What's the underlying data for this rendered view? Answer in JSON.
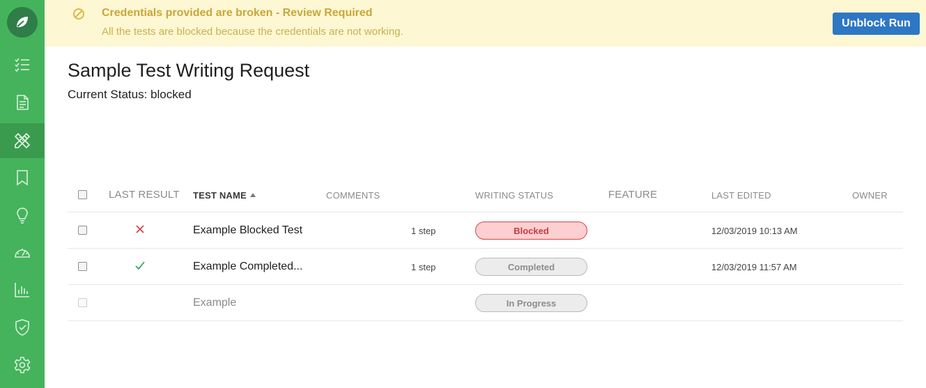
{
  "colors": {
    "sidebar": "#45b35c",
    "sidebar_active": "#3a9b4f",
    "banner_bg": "#fdf7d3",
    "banner_text": "#c8a73b",
    "primary_button": "#2d77c4",
    "blocked_red": "#d9434b",
    "success_green": "#3aa85a"
  },
  "sidebar": {
    "logo_icon": "leaf-icon",
    "items": [
      {
        "icon": "checklist-icon"
      },
      {
        "icon": "document-icon"
      },
      {
        "icon": "pencil-ruler-icon",
        "active": true
      },
      {
        "icon": "bookmark-icon"
      },
      {
        "icon": "lightbulb-icon"
      },
      {
        "icon": "speedometer-icon"
      },
      {
        "icon": "bar-chart-icon"
      },
      {
        "icon": "shield-check-icon"
      },
      {
        "icon": "gear-icon"
      }
    ]
  },
  "banner": {
    "icon": "blocked-icon",
    "title": "Credentials provided are broken - Review Required",
    "subtitle": "All the tests are blocked because the credentials are not working.",
    "button_label": "Unblock Run"
  },
  "page": {
    "title": "Sample Test Writing Request",
    "status": "Current Status: blocked"
  },
  "table": {
    "columns": {
      "last_result": "LAST RESULT",
      "test_name": "TEST NAME",
      "comments": "COMMENTS",
      "writing_status": "WRITING STATUS",
      "feature": "FEATURE",
      "last_edited": "LAST EDITED",
      "owner": "OWNER"
    },
    "rows": [
      {
        "result": "fail",
        "result_icon": "x-icon",
        "name": "Example Blocked Test",
        "steps": "1 step",
        "status": "Blocked",
        "edited": "12/03/2019 10:13 AM"
      },
      {
        "result": "pass",
        "result_icon": "check-icon",
        "name": "Example Completed...",
        "steps": "1 step",
        "status": "Completed",
        "edited": "12/03/2019 11:57 AM"
      },
      {
        "result": "",
        "name": "Example",
        "steps": "",
        "status": "In Progress",
        "edited": ""
      }
    ]
  }
}
